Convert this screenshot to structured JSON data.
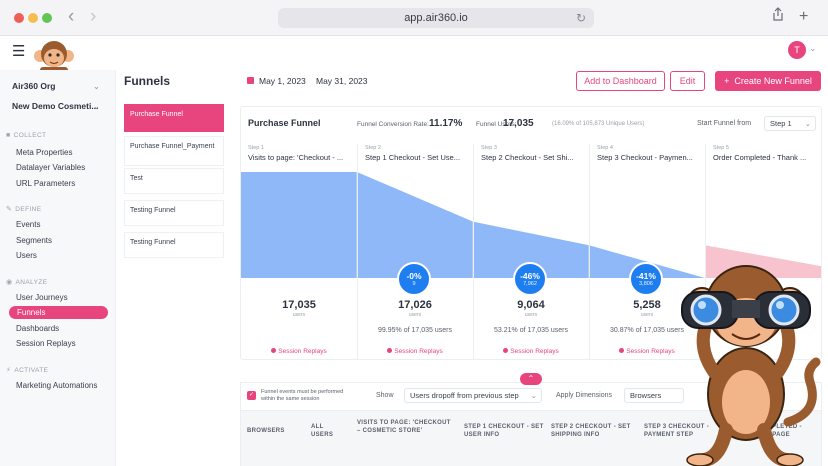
{
  "browser": {
    "url": "app.air360.io",
    "back_icon": "chevron-left",
    "forward_icon": "chevron-right",
    "reload_icon": "reload",
    "share_icon": "share",
    "new_tab_icon": "plus"
  },
  "app": {
    "user_initial": "T",
    "menu_icon": "hamburger",
    "accent_color": "#e8457f",
    "chart_blue": "#8fb8f8",
    "badge_blue": "#1e7ef0"
  },
  "sidebar": {
    "org_select": "Air360 Org",
    "project_select": "New Demo Cosmeti...",
    "sections": [
      {
        "title": "COLLECT",
        "items": [
          "Meta Properties",
          "Datalayer Variables",
          "URL Parameters"
        ]
      },
      {
        "title": "DEFINE",
        "items": [
          "Events",
          "Segments",
          "Users"
        ]
      },
      {
        "title": "ANALYZE",
        "items": [
          "User Journeys",
          "Funnels",
          "Dashboards",
          "Session Replays"
        ]
      },
      {
        "title": "ACTIVATE",
        "items": [
          "Marketing Automations"
        ]
      }
    ],
    "active_item": "Funnels"
  },
  "header": {
    "title": "Funnels",
    "date_from": "May 1, 2023",
    "date_to": "May 31, 2023",
    "add_dashboard": "Add to Dashboard",
    "edit": "Edit",
    "create_new": "Create New Funnel",
    "create_icon": "+"
  },
  "funnel_list": [
    "Purchase Funnel",
    "Purchase Funnel_Payment",
    "Test",
    "Testing Funnel",
    "Testing Funnel"
  ],
  "funnel": {
    "title": "Purchase Funnel",
    "conversion_label": "Funnel Conversion Rate:",
    "conversion_value": "11.17%",
    "users_label": "Funnel Users:",
    "users_value": "17,035",
    "users_note": "(16.09% of 105,873 Unique Users)",
    "start_label": "Start Funnel from",
    "start_value": "Step 1",
    "users_unit": "users",
    "replay_label": "Session Replays",
    "steps": [
      {
        "num": "Step 1",
        "name": "Visits to page: 'Checkout - ...",
        "users": "17,035",
        "pct": "",
        "drop_pct": "",
        "drop_cnt": ""
      },
      {
        "num": "Step 2",
        "name": "Step 1 Checkout - Set Use...",
        "users": "17,026",
        "pct": "99.95% of 17,035 users",
        "drop_pct": "-0%",
        "drop_cnt": "9"
      },
      {
        "num": "Step 3",
        "name": "Step 2 Checkout - Set Shi...",
        "users": "9,064",
        "pct": "53.21% of 17,035 users",
        "drop_pct": "-46%",
        "drop_cnt": "7,962"
      },
      {
        "num": "Step 4",
        "name": "Step 3 Checkout - Paymen...",
        "users": "5,258",
        "pct": "30.87% of 17,035 users",
        "drop_pct": "-41%",
        "drop_cnt": "3,806"
      },
      {
        "num": "Step 5",
        "name": "Order Completed - Thank ...",
        "users": "",
        "pct": "",
        "drop_pct": "",
        "drop_cnt": ""
      }
    ]
  },
  "chart_data": {
    "type": "area",
    "categories": [
      "Step 1",
      "Step 2",
      "Step 3",
      "Step 4",
      "Step 5"
    ],
    "values": [
      17035,
      17026,
      9064,
      5258,
      1903
    ]
  },
  "lower": {
    "collapse_icon": "chevron-up",
    "checkbox_label": "Funnel events must be performed within the same session",
    "show_label": "Show",
    "show_value": "Users dropoff from previous step",
    "apply_label": "Apply Dimensions",
    "dimension_value": "Browsers",
    "columns": [
      "BROWSERS",
      "ALL USERS",
      "VISITS TO PAGE: 'CHECKOUT – COSMETIC STORE'",
      "STEP 1 CHECKOUT - SET USER INFO",
      "STEP 2 CHECKOUT - SET SHIPPING INFO",
      "STEP 3 CHECKOUT - PAYMENT STEP",
      "ORDER COMPLETED - THANK YOU PAGE"
    ]
  }
}
